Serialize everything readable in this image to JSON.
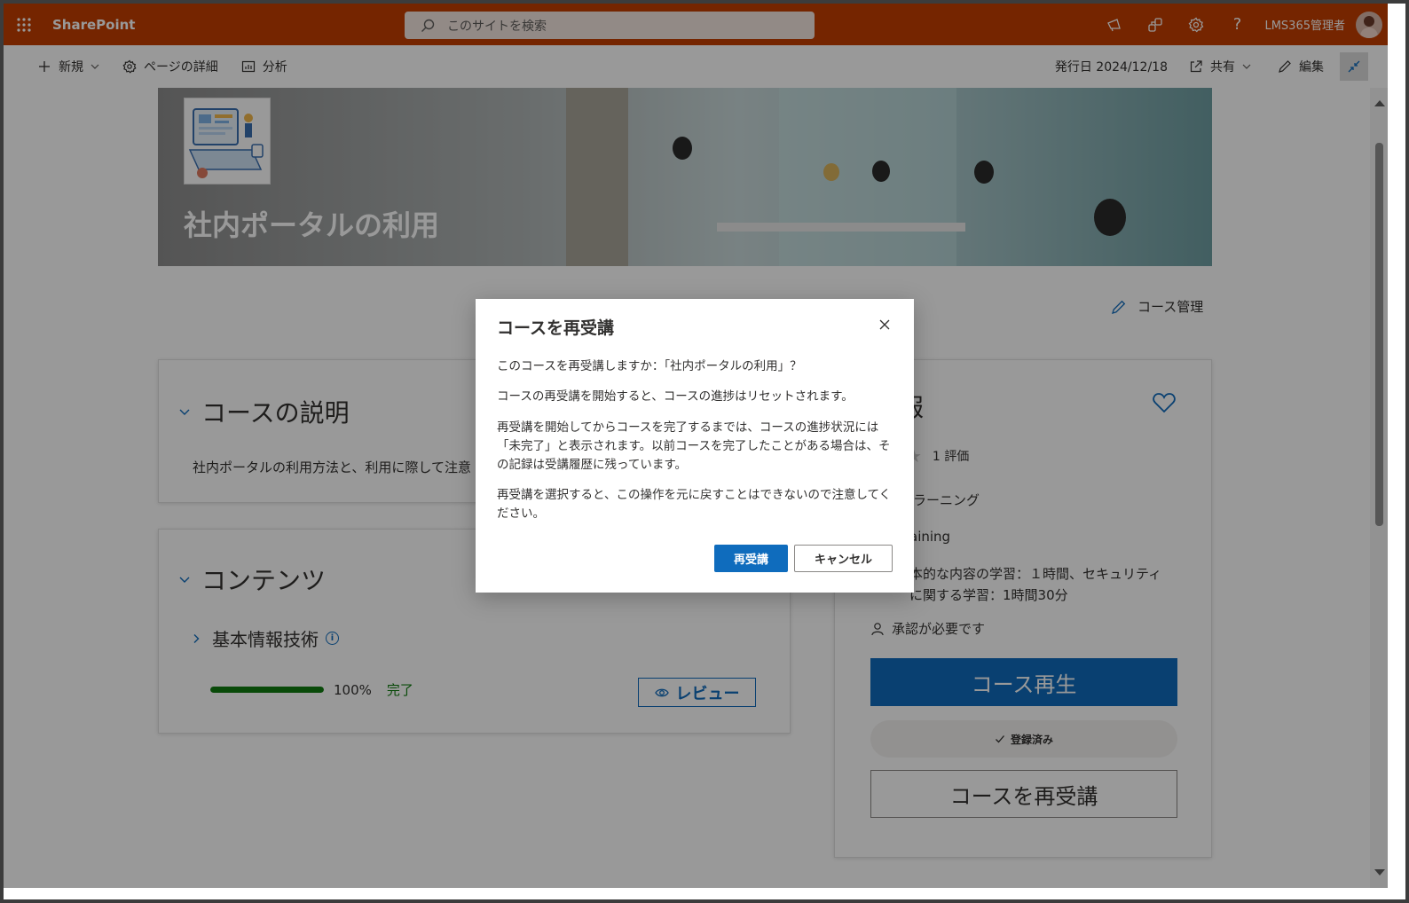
{
  "suitebar": {
    "brand": "SharePoint",
    "search_placeholder": "このサイトを検索",
    "user_name": "LMS365管理者",
    "icons": [
      "waffle-icon",
      "megaphone-icon",
      "share-network-icon",
      "settings-icon",
      "help-icon"
    ],
    "help_glyph": "?"
  },
  "cmdbar": {
    "new_label": "新規",
    "page_details_label": "ページの詳細",
    "analytics_label": "分析",
    "published": "発行日 2024/12/18",
    "share_label": "共有",
    "edit_label": "編集"
  },
  "hero": {
    "title": "社内ポータルの利用"
  },
  "manage": {
    "label": "コース管理"
  },
  "description_card": {
    "heading": "コースの説明",
    "text": "社内ポータルの利用方法と、利用に際して注意"
  },
  "content_card": {
    "heading": "コンテンツ",
    "module_title": "基本情報技術",
    "info_glyph": "i",
    "progress_percent": 100,
    "progress_label": "100%",
    "status": "完了",
    "review_label": "レビュー"
  },
  "info_card": {
    "heading_fragment": "報",
    "stars_filled_visible": 1,
    "stars_empty": 1,
    "rating_count": "1 評価",
    "type_fragment": "ラーニング",
    "category_fragment": "aining",
    "duration_line1": "本的な内容の学習：１時間、セキュリティ",
    "duration_line2": "に関する学習：1時間30分",
    "approval": "承認が必要です",
    "play_label": "コース再生",
    "registered_label": "登録済み",
    "retake_label": "コースを再受講"
  },
  "dialog": {
    "title": "コースを再受講",
    "p1": "このコースを再受講しますか：「社内ポータルの利用」？",
    "p2": "コースの再受講を開始すると、コースの進捗はリセットされます。",
    "p3": "再受講を開始してからコースを完了するまでは、コースの進捗状況には「未完了」と表示されます。以前コースを完了したことがある場合は、その記録は受講履歴に残っています。",
    "p4": "再受講を選択すると、この操作を元に戻すことはできないので注意してください。",
    "primary_label": "再受講",
    "secondary_label": "キャンセル"
  },
  "colors": {
    "suitebar": "#c43e00",
    "primary": "#0f6cbd",
    "success": "#107c10"
  }
}
